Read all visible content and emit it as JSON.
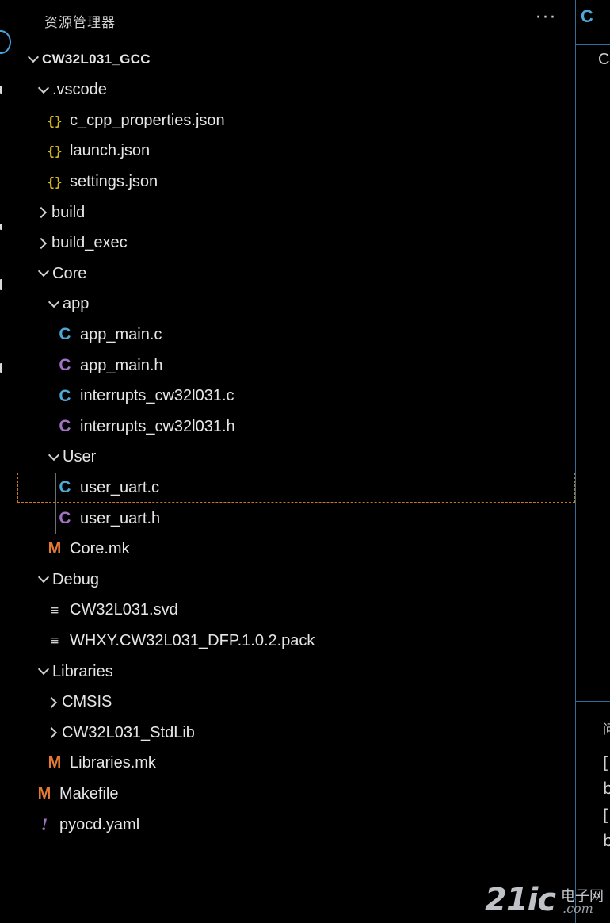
{
  "explorer": {
    "title": "资源管理器",
    "more_glyph": "···",
    "tree": [
      {
        "label": "CW32L031_GCC",
        "type": "folder-open",
        "depth": 0,
        "root": true
      },
      {
        "label": ".vscode",
        "type": "folder-open",
        "depth": 1
      },
      {
        "label": "c_cpp_properties.json",
        "type": "json",
        "depth": 2
      },
      {
        "label": "launch.json",
        "type": "json",
        "depth": 2
      },
      {
        "label": "settings.json",
        "type": "json",
        "depth": 2
      },
      {
        "label": "build",
        "type": "folder-closed",
        "depth": 1
      },
      {
        "label": "build_exec",
        "type": "folder-closed",
        "depth": 1
      },
      {
        "label": "Core",
        "type": "folder-open",
        "depth": 1
      },
      {
        "label": "app",
        "type": "folder-open",
        "depth": 2
      },
      {
        "label": "app_main.c",
        "type": "c",
        "depth": 3
      },
      {
        "label": "app_main.h",
        "type": "h",
        "depth": 3
      },
      {
        "label": "interrupts_cw32l031.c",
        "type": "c",
        "depth": 3
      },
      {
        "label": "interrupts_cw32l031.h",
        "type": "h",
        "depth": 3
      },
      {
        "label": "User",
        "type": "folder-open",
        "depth": 2
      },
      {
        "label": "user_uart.c",
        "type": "c",
        "depth": 3,
        "selected": true
      },
      {
        "label": "user_uart.h",
        "type": "h",
        "depth": 3
      },
      {
        "label": "Core.mk",
        "type": "mk",
        "depth": 2
      },
      {
        "label": "Debug",
        "type": "folder-open",
        "depth": 1
      },
      {
        "label": "CW32L031.svd",
        "type": "text",
        "depth": 2
      },
      {
        "label": "WHXY.CW32L031_DFP.1.0.2.pack",
        "type": "text",
        "depth": 2
      },
      {
        "label": "Libraries",
        "type": "folder-open",
        "depth": 1
      },
      {
        "label": "CMSIS",
        "type": "folder-closed",
        "depth": 2
      },
      {
        "label": "CW32L031_StdLib",
        "type": "folder-closed",
        "depth": 2
      },
      {
        "label": "Libraries.mk",
        "type": "mk",
        "depth": 2
      },
      {
        "label": "Makefile",
        "type": "mk",
        "depth": 1
      },
      {
        "label": "pyocd.yaml",
        "type": "yaml",
        "depth": 1
      }
    ],
    "icon_glyphs": {
      "json": "{}",
      "c": "C",
      "h": "C",
      "mk": "M",
      "text": "≡",
      "yaml": "!"
    }
  },
  "right_pane": {
    "tab_glyph": "C",
    "crumb": "C",
    "fragments": [
      "问",
      "[",
      "b",
      "[",
      "b"
    ]
  },
  "watermark": {
    "brand": "21ic",
    "cn": "电子网",
    "domain": ".com"
  },
  "colors": {
    "json_icon": "#d7ba1d",
    "c_icon": "#4fa8d6",
    "h_icon": "#a074c4",
    "mk_icon": "#e37933",
    "selection_outline": "#c7781c"
  }
}
